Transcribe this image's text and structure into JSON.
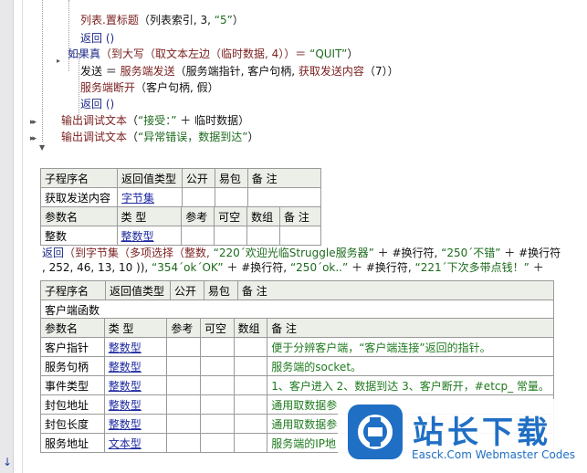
{
  "code": {
    "line1": {
      "a": "列表.置标题",
      "b": "（列表索引, 3, ",
      "c": "“5”",
      "d": "）"
    },
    "line2": "返回 ()",
    "line3": {
      "a": "如果真",
      "b": "（到大写（取文本左边（临时数据, 4））＝ ",
      "c": "“QUIT”",
      "d": "）"
    },
    "line4": {
      "a": "发送 ＝ ",
      "b": "服务端发送",
      "c": "（服务端指针, 客户句柄, ",
      "d": "获取发送内容",
      "e": "（7））"
    },
    "line5": {
      "a": "服务端断开",
      "b": "（客户句柄, 假）"
    },
    "line6": "返回 ()",
    "line7": {
      "a": "输出调试文本",
      "b": "（",
      "c": "“接受：”",
      "d": " ＋ 临时数据）"
    },
    "line8": {
      "a": "输出调试文本",
      "b": "（",
      "c": "“异常错误，数据到达”",
      "d": "）"
    }
  },
  "markers": [
    "▸▸",
    "▸▸"
  ],
  "table1": {
    "header": [
      "子程序名",
      "返回值类型",
      "公开",
      "易包",
      "备 注"
    ],
    "row": [
      "获取发送内容",
      "字节集",
      "",
      "",
      ""
    ],
    "param_header": [
      "参数名",
      "类 型",
      "参考",
      "可空",
      "数组",
      "备 注"
    ],
    "params": [
      [
        "整数",
        "整数型",
        "",
        "",
        "",
        ""
      ]
    ]
  },
  "return_line": {
    "l1a": "返回",
    "l1b": "（到字节集（多项选择（整数, ",
    "l1c": "“220´欢迎光临Struggle服务器”",
    "l1d": " ＋ #换行符, ",
    "l1e": "“250´不错”",
    "l1f": " ＋ #换行符",
    "l2a": ", 252, 46, 13, 10 )), ",
    "l2b": "“354´ok´OK”",
    "l2c": " ＋ #换行符, ",
    "l2d": "“250´ok..”",
    "l2e": " ＋ #换行符, ",
    "l2f": "“221´下次多带点钱！”",
    "l2g": " ＋"
  },
  "table2": {
    "header": [
      "子程序名",
      "返回值类型",
      "公开",
      "易包",
      "备 注"
    ],
    "row": [
      "客户端函数"
    ],
    "param_header": [
      "参数名",
      "类 型",
      "参考",
      "可空",
      "数组",
      "备 注"
    ],
    "params": [
      [
        "客户指针",
        "整数型",
        "",
        "",
        "",
        "便于分辨客户端，“客户端连接”返回的指针。"
      ],
      [
        "服务句柄",
        "整数型",
        "",
        "",
        "",
        "服务端的socket。"
      ],
      [
        "事件类型",
        "整数型",
        "",
        "",
        "",
        "1、客户进入 2、数据到达 3、客户断开，#etcp_ 常量。"
      ],
      [
        "封包地址",
        "整数型",
        "",
        "",
        "",
        "通用取数据参"
      ],
      [
        "封包长度",
        "整数型",
        "",
        "",
        "",
        "通用取数据参"
      ],
      [
        "服务地址",
        "文本型",
        "",
        "",
        "",
        "服务端的IP地"
      ]
    ]
  },
  "watermark": {
    "title": "站长下载",
    "subtitle": "Easck.Com Webmaster Codes",
    "brand_color": "#1f6fc4"
  },
  "scroll_arrow": "↓"
}
